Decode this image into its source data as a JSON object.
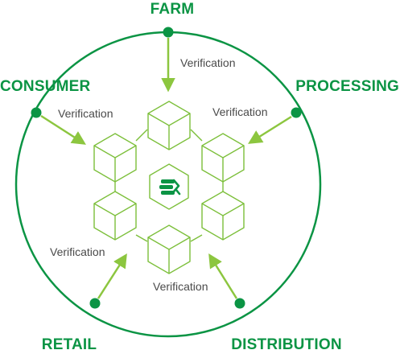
{
  "colors": {
    "dark_green": "#0b9444",
    "light_green": "#8cc63f",
    "cube_stroke": "#7cbf3a",
    "label_gray": "#4a4a4a"
  },
  "stages": {
    "farm": "FARM",
    "processing": "PROCESSING",
    "distribution": "DISTRIBUTION",
    "retail": "RETAIL",
    "consumer": "CONSUMER"
  },
  "verifications": {
    "farm": "Verification",
    "processing": "Verification",
    "distribution": "Verification",
    "retail": "Verification",
    "consumer": "Verification"
  },
  "center_logo": "chain-logo-icon"
}
